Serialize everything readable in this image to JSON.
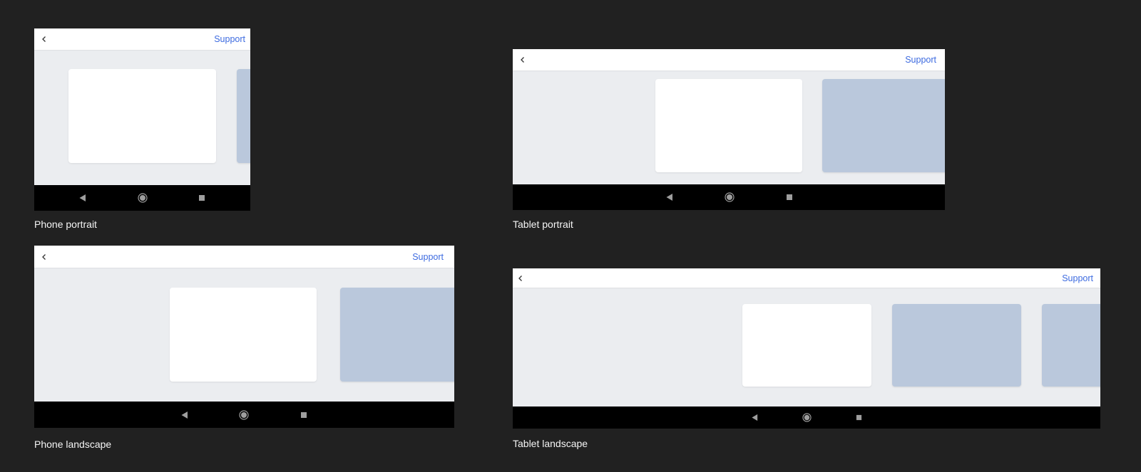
{
  "colors": {
    "background": "#212121",
    "content": "#ebedf0",
    "card_white": "#ffffff",
    "card_blue": "#bac8dc",
    "link": "#3d6be0",
    "navbar": "#000000",
    "nav_icon": "#9e9e9e"
  },
  "devices": {
    "phone_portrait": {
      "caption": "Phone portrait",
      "support_label": "Support",
      "icons": {
        "back": "chevron-left-icon",
        "nav_back": "back-triangle-icon",
        "nav_home": "home-circle-icon",
        "nav_recents": "recents-square-icon"
      }
    },
    "tablet_portrait": {
      "caption": "Tablet portrait",
      "support_label": "Support",
      "icons": {
        "back": "chevron-left-icon",
        "nav_back": "back-triangle-icon",
        "nav_home": "home-circle-icon",
        "nav_recents": "recents-square-icon"
      }
    },
    "phone_landscape": {
      "caption": "Phone landscape",
      "support_label": "Support",
      "icons": {
        "back": "chevron-left-icon",
        "nav_back": "back-triangle-icon",
        "nav_home": "home-circle-icon",
        "nav_recents": "recents-square-icon"
      }
    },
    "tablet_landscape": {
      "caption": "Tablet landscape",
      "support_label": "Support",
      "icons": {
        "back": "chevron-left-icon",
        "nav_back": "back-triangle-icon",
        "nav_home": "home-circle-icon",
        "nav_recents": "recents-square-icon"
      }
    }
  }
}
